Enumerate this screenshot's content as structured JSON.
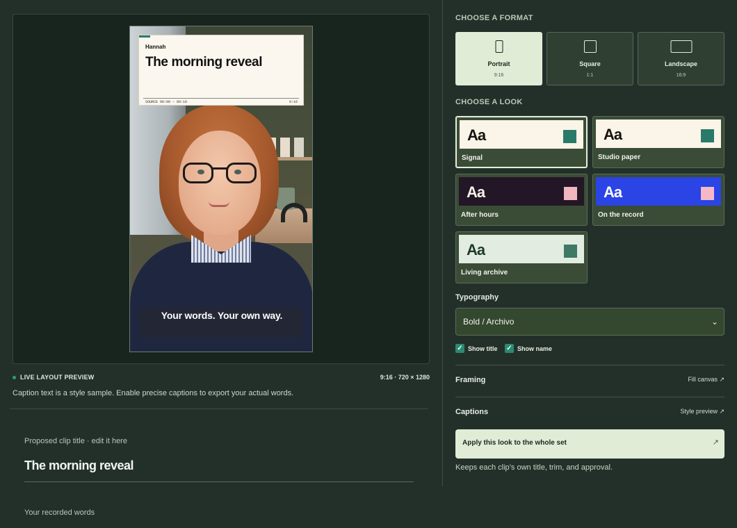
{
  "preview": {
    "card": {
      "name": "Hannah",
      "title": "The morning reveal",
      "source": "SOURCE  00:00 – 00:10",
      "ratio": "9:16"
    },
    "caption": "Your words. Your own way.",
    "label": "LIVE LAYOUT PREVIEW",
    "dims": "9:16 · 720 × 1280",
    "note": "Caption text is a style sample. Enable precise captions to export your actual words."
  },
  "clip": {
    "title_label": "Proposed clip title · edit it here",
    "title_value": "The morning reveal",
    "words_label": "Your recorded words"
  },
  "formats": {
    "heading": "CHOOSE A FORMAT",
    "items": [
      {
        "name": "Portrait",
        "ratio": "9:16",
        "selected": true
      },
      {
        "name": "Square",
        "ratio": "1:1",
        "selected": false
      },
      {
        "name": "Landscape",
        "ratio": "16:9",
        "selected": false
      }
    ]
  },
  "looks": {
    "heading": "CHOOSE A LOOK",
    "items": [
      {
        "name": "Signal",
        "sample": "Aa",
        "bg": "#fbf4e8",
        "text": "#14120f",
        "chip": "#2a7a6a",
        "selected": true
      },
      {
        "name": "Studio paper",
        "sample": "Aa",
        "bg": "#fbf4e8",
        "text": "#14120f",
        "chip": "#2a7a6a",
        "selected": false
      },
      {
        "name": "After hours",
        "sample": "Aa",
        "bg": "#231626",
        "text": "#f6f1ec",
        "chip": "#f2b6c0",
        "selected": false
      },
      {
        "name": "On the record",
        "sample": "Aa",
        "bg": "#2a44e6",
        "text": "#ffffff",
        "chip": "#f6b8c6",
        "selected": false
      },
      {
        "name": "Living archive",
        "sample": "Aa",
        "bg": "#e3ece0",
        "text": "#1c3a2c",
        "chip": "#3f7a66",
        "selected": false
      }
    ]
  },
  "typography": {
    "label": "Typography",
    "value": "Bold / Archivo",
    "show_title": "Show title",
    "show_name": "Show name"
  },
  "framing": {
    "label": "Framing",
    "link": "Fill canvas ↗"
  },
  "captions": {
    "label": "Captions",
    "link": "Style preview ↗"
  },
  "apply": {
    "label": "Apply this look to the whole set",
    "arrow": "↗",
    "note": "Keeps each clip’s own title, trim, and approval."
  },
  "icons": {
    "check": "check-icon",
    "chevron": "chevron-down-icon",
    "arrow": "arrow-up-right-icon"
  }
}
